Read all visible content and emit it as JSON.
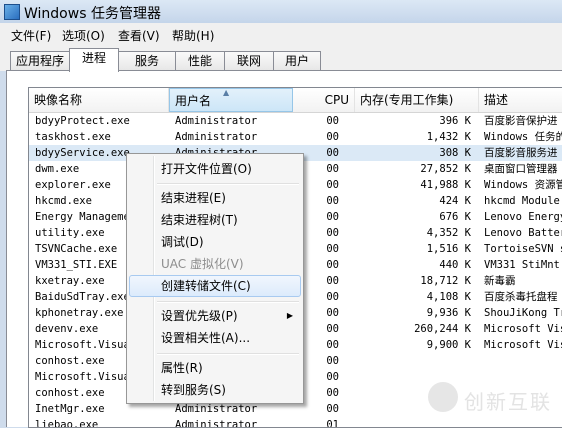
{
  "window": {
    "title": "Windows 任务管理器"
  },
  "menu": [
    "文件(F)",
    "选项(O)",
    "查看(V)",
    "帮助(H)"
  ],
  "tabs": [
    "应用程序",
    "进程",
    "服务",
    "性能",
    "联网",
    "用户"
  ],
  "active_tab": "进程",
  "columns": {
    "name": "映像名称",
    "user": "用户名",
    "cpu": "CPU",
    "mem": "内存(专用工作集)",
    "desc": "描述"
  },
  "processes": [
    {
      "name": "bdyyProtect.exe",
      "user": "Administrator",
      "cpu": "00",
      "mem": "396 K",
      "desc": "百度影音保护进"
    },
    {
      "name": "taskhost.exe",
      "user": "Administrator",
      "cpu": "00",
      "mem": "1,432 K",
      "desc": "Windows 任务的"
    },
    {
      "name": "bdyyService.exe",
      "user": "Administrator",
      "cpu": "00",
      "mem": "308 K",
      "desc": "百度影音服务进"
    },
    {
      "name": "dwm.exe",
      "user": "",
      "cpu": "00",
      "mem": "27,852 K",
      "desc": "桌面窗口管理器"
    },
    {
      "name": "explorer.exe",
      "user": "",
      "cpu": "00",
      "mem": "41,988 K",
      "desc": "Windows 资源管"
    },
    {
      "name": "hkcmd.exe",
      "user": "",
      "cpu": "00",
      "mem": "424 K",
      "desc": "hkcmd Module"
    },
    {
      "name": "Energy Manageme",
      "user": "",
      "cpu": "00",
      "mem": "676 K",
      "desc": "Lenovo Energy"
    },
    {
      "name": "utility.exe",
      "user": "",
      "cpu": "00",
      "mem": "4,352 K",
      "desc": "Lenovo Batter"
    },
    {
      "name": "TSVNCache.exe",
      "user": "",
      "cpu": "00",
      "mem": "1,516 K",
      "desc": "TortoiseSVN s"
    },
    {
      "name": "VM331_STI.EXE",
      "user": "",
      "cpu": "00",
      "mem": "440 K",
      "desc": "VM331 StiMnt"
    },
    {
      "name": "kxetray.exe",
      "user": "",
      "cpu": "00",
      "mem": "18,712 K",
      "desc": "新毒霸"
    },
    {
      "name": "BaiduSdTray.exe",
      "user": "",
      "cpu": "00",
      "mem": "4,108 K",
      "desc": "百度杀毒托盘程"
    },
    {
      "name": "kphonetray.exe",
      "user": "",
      "cpu": "00",
      "mem": "9,936 K",
      "desc": "ShouJiKong Tr"
    },
    {
      "name": "devenv.exe",
      "user": "",
      "cpu": "00",
      "mem": "260,244 K",
      "desc": "Microsoft Vis"
    },
    {
      "name": "Microsoft.Visua",
      "user": "",
      "cpu": "00",
      "mem": "9,900 K",
      "desc": "Microsoft Vis"
    },
    {
      "name": "conhost.exe",
      "user": "",
      "cpu": "00",
      "mem": "",
      "desc": ""
    },
    {
      "name": "Microsoft.Visua",
      "user": "",
      "cpu": "00",
      "mem": "",
      "desc": ""
    },
    {
      "name": "conhost.exe",
      "user": "",
      "cpu": "00",
      "mem": "",
      "desc": ""
    },
    {
      "name": "InetMgr.exe",
      "user": "Administrator",
      "cpu": "00",
      "mem": "",
      "desc": ""
    },
    {
      "name": "liebao.exe",
      "user": "Administrator",
      "cpu": "01",
      "mem": "",
      "desc": ""
    }
  ],
  "selected_row": 2,
  "context_menu": {
    "items": [
      "打开文件位置(O)",
      "结束进程(E)",
      "结束进程树(T)",
      "调试(D)",
      "UAC 虚拟化(V)",
      "创建转储文件(C)",
      "设置优先级(P)",
      "设置相关性(A)...",
      "属性(R)",
      "转到服务(S)"
    ],
    "disabled": "UAC 虚拟化(V)",
    "highlighted": "创建转储文件(C)"
  },
  "watermark": "创新互联"
}
